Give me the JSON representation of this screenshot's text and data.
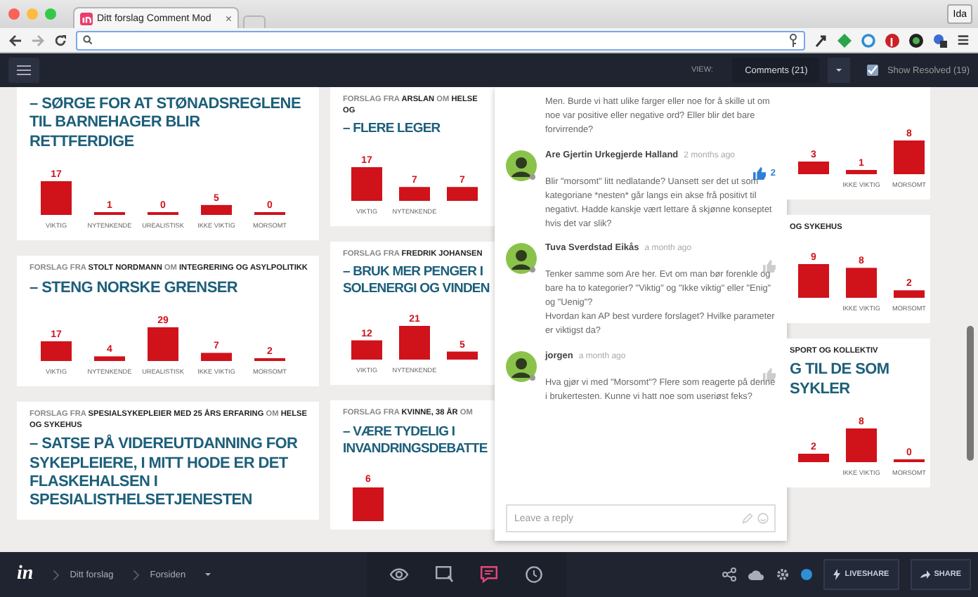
{
  "browser": {
    "tab": {
      "title": "Ditt forslag Comment Mod",
      "close": "×"
    },
    "profile": "Ida"
  },
  "toolbar": {
    "view_label": "VIEW:",
    "view_select": "Comments (21)",
    "show_resolved": {
      "label": "Show Resolved (19)",
      "checked": true
    }
  },
  "columns": [
    {
      "cards": [
        {
          "title": "– SØRGE FOR AT STØNADSREGLENE TIL BARNEHAGER BLIR RETTFERDIGE",
          "chart_data": {
            "type": "bar",
            "categories": [
              "VIKTIG",
              "NYTENKENDE",
              "UREALISTISK",
              "IKKE VIKTIG",
              "MORSOMT"
            ],
            "values": [
              17,
              1,
              0,
              5,
              0
            ],
            "data_labels": true
          }
        },
        {
          "header": "FORSLAG FRA **STOLT NORDMANN** OM **INTEGRERING OG ASYLPOLITIKK**",
          "title": "– STENG NORSKE GRENSER",
          "chart_data": {
            "type": "bar",
            "categories": [
              "VIKTIG",
              "NYTENKENDE",
              "UREALISTISK",
              "IKKE VIKTIG",
              "MORSOMT"
            ],
            "values": [
              17,
              4,
              29,
              7,
              2
            ],
            "data_labels": true
          }
        },
        {
          "header": "FORSLAG FRA **SPESIALSYKEPLEIER MED 25 ÅRS ERFARING** OM **HELSE OG SYKEHUS**",
          "title": "– SATSE PÅ VIDEREUTDANNING FOR SYKEPLEIERE, I MITT HODE ER DET FLASKEHALSEN I SPESIALISTHELSETJENESTEN"
        }
      ]
    },
    {
      "cards": [
        {
          "header": "FORSLAG FRA **ARSLAN** OM **HELSE OG**",
          "title": "– FLERE LEGER",
          "chart_data": {
            "type": "bar",
            "categories": [
              "VIKTIG",
              "NYTENKENDE",
              null
            ],
            "values": [
              17,
              7,
              7
            ],
            "data_labels": true
          }
        },
        {
          "header": "FORSLAG FRA **FREDRIK JOHANSEN**",
          "title": "– BRUK MER PENGER I SOLENERGI OG VINDEN",
          "chart_data": {
            "type": "bar",
            "categories": [
              "VIKTIG",
              "NYTENKENDE",
              null
            ],
            "values": [
              12,
              21,
              5
            ],
            "data_labels": true
          }
        },
        {
          "header": "FORSLAG FRA **KVINNE, 38 ÅR** OM",
          "title": "– VÆRE TYDELIG I INVANDRINGSDEBATTE",
          "bar_value": "6"
        }
      ]
    },
    {
      "cards": [
        {
          "chart_data": {
            "type": "bar",
            "categories": [
              null,
              "IKKE VIKTIG",
              "MORSOMT"
            ],
            "values": [
              3,
              1,
              8
            ],
            "data_labels": true
          }
        },
        {
          "header": "**OG SYKEHUS**",
          "chart_data": {
            "type": "bar",
            "categories": [
              null,
              "IKKE VIKTIG",
              "MORSOMT"
            ],
            "values": [
              9,
              8,
              2
            ],
            "data_labels": true
          }
        },
        {
          "header": "**SPORT OG KOLLEKTIV**",
          "title": "G TIL DE SOM SYKLER",
          "chart_data": {
            "type": "bar",
            "categories": [
              null,
              "IKKE VIKTIG",
              "MORSOMT"
            ],
            "values": [
              2,
              8,
              0
            ],
            "data_labels": true
          }
        }
      ]
    }
  ],
  "comments": {
    "items": [
      {
        "text": "Men. Burde vi hatt ulike farger eller noe for å skille ut om noe var positive eller negative ord? Eller blir det bare forvirrende?"
      },
      {
        "author": "Are Gjertin Urkegjerde Halland",
        "time": "2 months ago",
        "likes": "2",
        "text": "Blir \"morsomt\" litt nedlatande? Uansett ser det ut som kategoriane *nesten* går langs ein akse frå positivt til negativt. Hadde kanskje vært lettare å skjønne konseptet hvis det var slik?"
      },
      {
        "author": "Tuva Sverdstad Eikås",
        "time": "a month ago",
        "text": "Tenker samme som Are her. Evt om man bør forenkle og bare ha to kategorier? \"Viktig\" og \"Ikke viktig\" eller \"Enig\" og \"Uenig\"?\nHvordan kan AP best vurdere forslaget? Hvilke parameter er viktigst da?"
      },
      {
        "author": "jorgen",
        "time": "a month ago",
        "text": "Hva gjør vi med \"Morsomt\"? Flere som reagerte på denne i brukertesten. Kunne vi hatt noe som useriøst feks?"
      }
    ],
    "reply_placeholder": "Leave a reply"
  },
  "bottom_bar": {
    "logo": "in",
    "breadcrumbs": [
      "Ditt forslag",
      "Forsiden"
    ],
    "tools": [
      {
        "kind": "preview",
        "selected": false
      },
      {
        "kind": "build",
        "selected": false
      },
      {
        "kind": "comment",
        "selected": true
      },
      {
        "kind": "history",
        "selected": false
      }
    ],
    "buttons": [
      {
        "kind": "liveshare",
        "label": "LIVESHARE"
      },
      {
        "kind": "share",
        "label": "SHARE"
      }
    ]
  }
}
